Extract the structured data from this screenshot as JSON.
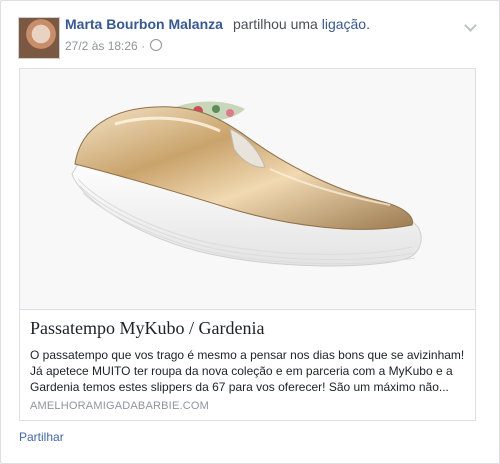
{
  "post": {
    "author": "Marta Bourbon Malanza",
    "action_prefix": "partilhou uma",
    "action_link": "ligação",
    "action_suffix": ".",
    "timestamp": "27/2 às 18:26",
    "separator": "·",
    "privacy_icon": "globe-icon",
    "options_icon": "chevron-down-icon"
  },
  "attachment": {
    "image_subject": "shoe-image",
    "title": "Passatempo MyKubo / Gardenia",
    "description": "O passatempo que vos trago é mesmo a pensar nos dias bons que se avizinham! Já apetece MUITO ter roupa da nova coleção e em parceria com a MyKubo e a Gardenia temos estes slippers da 67 para vos oferecer! São um máximo não...",
    "domain": "AMELHORAMIGADABARBIE.COM"
  },
  "actions": {
    "share_label": "Partilhar"
  },
  "colors": {
    "link": "#365899",
    "meta": "#90949c",
    "text": "#1d2129",
    "border": "#dddfe2"
  }
}
